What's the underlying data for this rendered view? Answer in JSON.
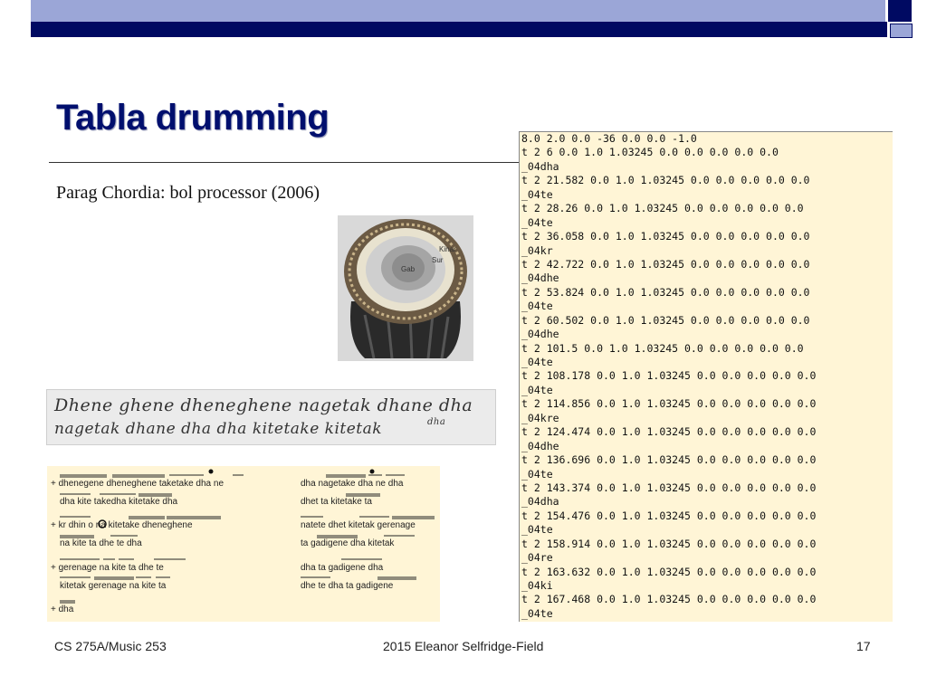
{
  "slide": {
    "title": "Tabla drumming",
    "subtitle": "Parag Chordia: bol processor (2006)",
    "page_number": "17"
  },
  "footer": {
    "left": "CS 275A/Music 253",
    "center": "2015 Eleanor Selfridge-Field",
    "right": "17"
  },
  "drum_labels": {
    "gab": "Gab",
    "kinar": "Kinar",
    "sur": "Sur"
  },
  "handwriting": {
    "line1": "Dhene ghene dheneghene nagetak dhane dha",
    "line2": "nagetak dhane dha dha kitetake kitetak",
    "note": "dha"
  },
  "notation": {
    "rows": [
      "+ dhenegene dheneghene taketake dha ne",
      "dha kite takedha kitetake dha",
      "+ kr dhin o na kitetake dheneghene",
      "na kite ta dhe te dha",
      "+ gerenage na kite ta dhe te",
      "kitetak gerenage na kite ta",
      "+ dha"
    ],
    "right_rows": [
      "dha nagetake dha ne dha",
      "dhet ta kitetake ta",
      "natete dhet kitetak gerenage",
      "ta gadigene dha kitetak",
      "dha ta gadigene dha",
      "dhe te dha ta gadigene"
    ]
  },
  "listing": [
    "8.0 2.0 0.0 -36 0.0 0.0 -1.0",
    "t 2 6 0.0 1.0 1.03245 0.0 0.0 0.0 0.0 0.0",
    "_04dha",
    "t 2 21.582 0.0 1.0 1.03245 0.0 0.0 0.0 0.0 0.0",
    "_04te",
    "t 2 28.26 0.0 1.0 1.03245 0.0 0.0 0.0 0.0 0.0",
    "_04te",
    "t 2 36.058 0.0 1.0 1.03245 0.0 0.0 0.0 0.0 0.0",
    "_04kr",
    "t 2 42.722 0.0 1.0 1.03245 0.0 0.0 0.0 0.0 0.0",
    "_04dhe",
    "t 2 53.824 0.0 1.0 1.03245 0.0 0.0 0.0 0.0 0.0",
    "_04te",
    "t 2 60.502 0.0 1.0 1.03245 0.0 0.0 0.0 0.0 0.0",
    "_04dhe",
    "t 2 101.5 0.0 1.0 1.03245 0.0 0.0 0.0 0.0 0.0",
    "_04te",
    "t 2 108.178 0.0 1.0 1.03245 0.0 0.0 0.0 0.0 0.0",
    "_04te",
    "t 2 114.856 0.0 1.0 1.03245 0.0 0.0 0.0 0.0 0.0",
    "_04kre",
    "t 2 124.474 0.0 1.0 1.03245 0.0 0.0 0.0 0.0 0.0",
    "_04dhe",
    "t 2 136.696 0.0 1.0 1.03245 0.0 0.0 0.0 0.0 0.0",
    "_04te",
    "t 2 143.374 0.0 1.0 1.03245 0.0 0.0 0.0 0.0 0.0",
    "_04dha",
    "t 2 154.476 0.0 1.0 1.03245 0.0 0.0 0.0 0.0 0.0",
    "_04te",
    "t 2 158.914 0.0 1.0 1.03245 0.0 0.0 0.0 0.0 0.0",
    "_04re",
    "t 2 163.632 0.0 1.0 1.03245 0.0 0.0 0.0 0.0 0.0",
    "_04ki",
    "t 2 167.468 0.0 1.0 1.03245 0.0 0.0 0.0 0.0 0.0",
    "_04te"
  ]
}
